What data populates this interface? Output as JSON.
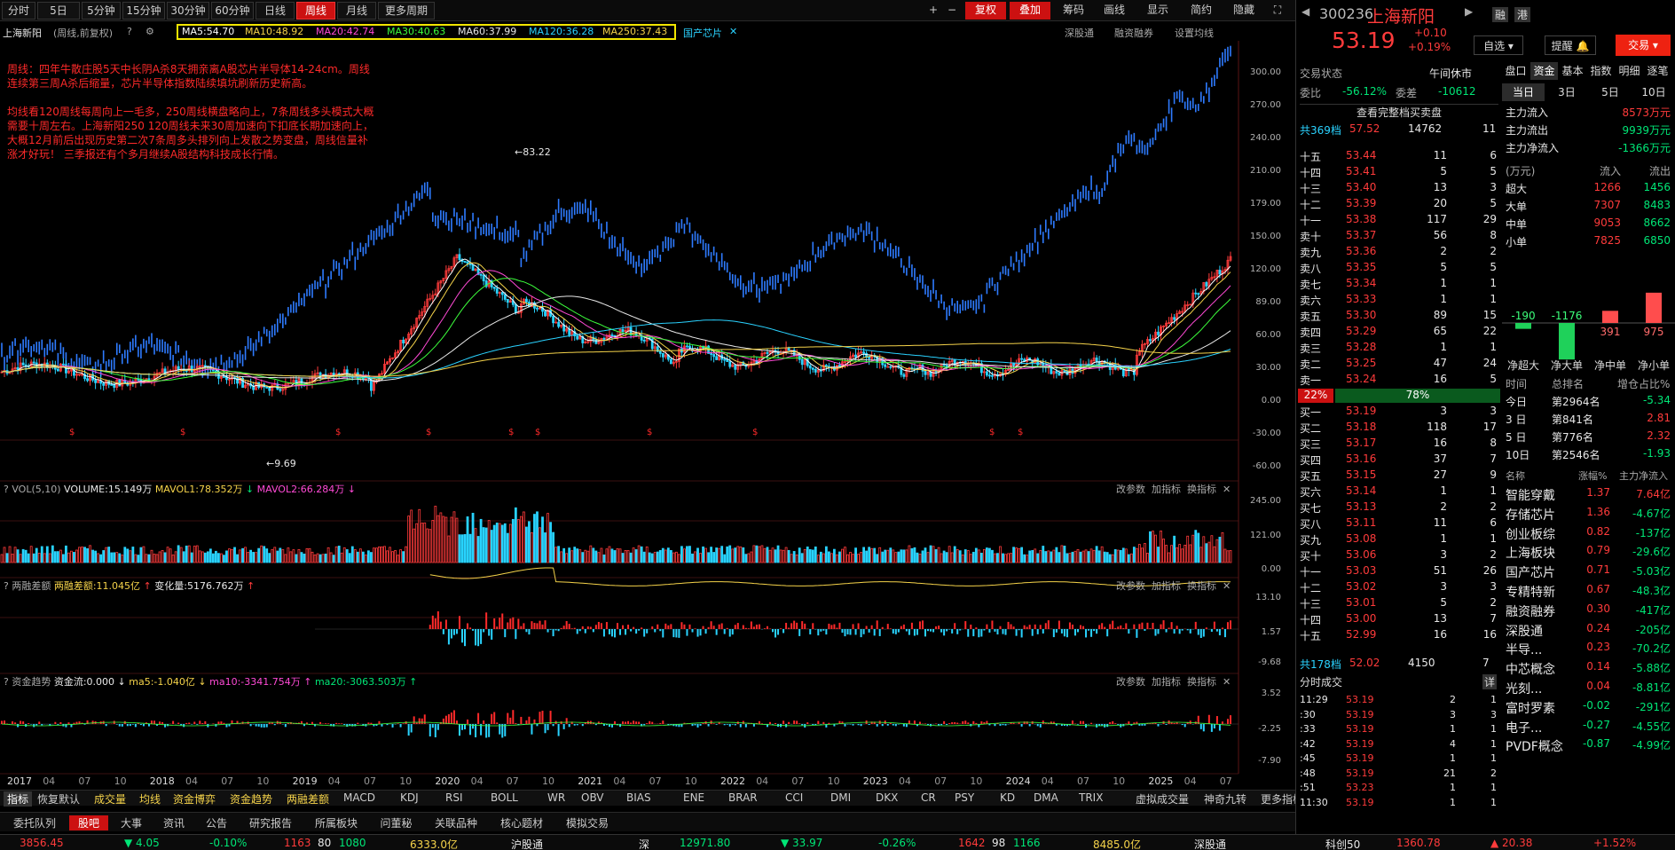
{
  "toolbar": {
    "items": [
      "分时",
      "5日",
      "5分钟",
      "15分钟",
      "30分钟",
      "60分钟",
      "日线",
      "周线",
      "月线",
      "更多周期"
    ],
    "right": [
      "复权",
      "叠加",
      "筹码",
      "画线",
      "显示",
      "简约",
      "隐藏"
    ]
  },
  "chart_header": {
    "name": "上海新阳",
    "period": "(周线,前复权)",
    "ma": [
      "MA5:54.70",
      "MA10:48.92",
      "MA20:42.74",
      "MA30:40.63",
      "MA60:37.99",
      "MA120:36.28",
      "MA250:37.43"
    ],
    "ma_colors": [
      "#ffffff",
      "#f5d34a",
      "#ff4ad6",
      "#3cff3c",
      "#e8e8e8",
      "#2ad2ff",
      "#f5d34a"
    ],
    "overlay": "国产芯片",
    "right_links": [
      "深股通",
      "融资融券",
      "设置均线"
    ]
  },
  "annotation": [
    "周线：四年牛散庄股5天中长阴A杀8天拥亲离A股芯片半导体14-24cm。周线",
    "连续第三周A杀后缩量，芯片半导体指数陆续填坑刷新历史新高。",
    "",
    "均线看120周线每周向上一毛多，250周线横盘略向上，7条周线多头模式大概",
    "需要十周左右。上海新阳250 120周线未来30周加速向下扣底长期加速向上，",
    "大概12月前后出现历史第二次7条周多头排列向上发散之势变盘，周线信量补",
    "涨才好玩！ 三季报还有个多月继续A股结构科技成长行情。"
  ],
  "main_y": [
    "300.00",
    "270.00",
    "240.00",
    "210.00",
    "179.00",
    "150.00",
    "120.00",
    "89.00",
    "60.00",
    "30.00",
    "0.00",
    "-30.00",
    "-60.00"
  ],
  "max_label": "83.22",
  "min_label": "9.69",
  "vol": {
    "title": "VOL(5,10)",
    "items": [
      "VOLUME:15.149万",
      "MAVOL1:78.352万",
      "MAVOL2:66.284万"
    ],
    "y": [
      "245.00",
      "121.00",
      "0.00"
    ],
    "btns": [
      "改参数",
      "加指标",
      "换指标"
    ]
  },
  "margin": {
    "title": "两融差额",
    "items": [
      "两融差额:11.045亿",
      "变化量:5176.762万"
    ],
    "y": [
      "13.10",
      "1.57",
      "-9.68"
    ]
  },
  "fund": {
    "title": "资金趋势",
    "items": [
      "资金流:0.000",
      "ma5:-1.040亿",
      "ma10:-3341.754万",
      "ma20:-3063.503万"
    ],
    "y": [
      "3.52",
      "-2.25",
      "-7.90"
    ]
  },
  "xaxis": [
    "2017",
    "04",
    "07",
    "10",
    "2018",
    "04",
    "07",
    "10",
    "2019",
    "04",
    "07",
    "10",
    "2020",
    "04",
    "07",
    "10",
    "2021",
    "04",
    "07",
    "10",
    "2022",
    "04",
    "07",
    "10",
    "2023",
    "04",
    "07",
    "10",
    "2024",
    "04",
    "07",
    "10",
    "2025",
    "04",
    "07"
  ],
  "indicators": [
    "指标",
    "恢复默认",
    "成交量",
    "均线",
    "资金博弈",
    "资金趋势",
    "两融差额",
    "MACD",
    "KDJ",
    "RSI",
    "BOLL",
    "WR",
    "OBV",
    "BIAS",
    "ENE",
    "BRAR",
    "CCI",
    "DMI",
    "DKX",
    "CR",
    "PSY",
    "KD",
    "DMA",
    "TRIX",
    "虚拟成交量",
    "神奇九转",
    "更多指标",
    "模板"
  ],
  "tabs": [
    "委托队列",
    "股吧",
    "大事",
    "资讯",
    "公告",
    "研究报告",
    "所属板块",
    "问董秘",
    "关联品种",
    "核心题材",
    "模拟交易"
  ],
  "status": {
    "idx1": "3856.45",
    "chg1": "4.05",
    "pct1": "-0.10%",
    "a1": "1163",
    "b1": "80",
    "c1": "1080",
    "amt1": "6333.0亿",
    "hgt": "沪股通",
    "sz": "深",
    "idx2": "12971.80",
    "chg2": "33.97",
    "pct2": "-0.26%",
    "a2": "1642",
    "b2": "98",
    "c2": "1166",
    "amt2": "8485.0亿",
    "sgt": "深股通",
    "kc": "科创50",
    "idx3": "1360.78",
    "chg3": "20.38",
    "pct3": "+1.52%"
  },
  "quote": {
    "code": "300236",
    "name": "上海新阳",
    "price": "53.19",
    "chg": "+0.10",
    "pct": "+0.19%",
    "btn_zx": "自选",
    "btn_tx": "提醒",
    "btn_jy": "交易",
    "tags": [
      "融",
      "港"
    ]
  },
  "rtabs": [
    "盘口",
    "资金",
    "基本",
    "指数",
    "明细",
    "逐笔"
  ],
  "state": {
    "label": "交易状态",
    "value": "午间休市",
    "wb_label": "委比",
    "wb": "-56.12%",
    "wc_label": "委差",
    "wc": "-10612",
    "full": "查看完整档买卖盘",
    "sum_label": "共369档",
    "sum_p": "57.52",
    "sum_v": "14762",
    "sum_n": "11"
  },
  "asks": [
    [
      "十五",
      "53.44",
      "11",
      "6"
    ],
    [
      "十四",
      "53.41",
      "5",
      "5"
    ],
    [
      "十三",
      "53.40",
      "13",
      "3"
    ],
    [
      "十二",
      "53.39",
      "20",
      "5"
    ],
    [
      "十一",
      "53.38",
      "117",
      "29"
    ],
    [
      "卖十",
      "53.37",
      "56",
      "8"
    ],
    [
      "卖九",
      "53.36",
      "2",
      "2"
    ],
    [
      "卖八",
      "53.35",
      "5",
      "5"
    ],
    [
      "卖七",
      "53.34",
      "1",
      "1"
    ],
    [
      "卖六",
      "53.33",
      "1",
      "1"
    ],
    [
      "卖五",
      "53.30",
      "89",
      "15"
    ],
    [
      "卖四",
      "53.29",
      "65",
      "22"
    ],
    [
      "卖三",
      "53.28",
      "1",
      "1"
    ],
    [
      "卖二",
      "53.25",
      "47",
      "24"
    ],
    [
      "卖一",
      "53.24",
      "16",
      "5"
    ]
  ],
  "ratio": [
    "22%",
    "78%"
  ],
  "bids": [
    [
      "买一",
      "53.19",
      "3",
      "3"
    ],
    [
      "买二",
      "53.18",
      "118",
      "17"
    ],
    [
      "买三",
      "53.17",
      "16",
      "8"
    ],
    [
      "买四",
      "53.16",
      "37",
      "7"
    ],
    [
      "买五",
      "53.15",
      "27",
      "9"
    ],
    [
      "买六",
      "53.14",
      "1",
      "1"
    ],
    [
      "买七",
      "53.13",
      "2",
      "2"
    ],
    [
      "买八",
      "53.11",
      "11",
      "6"
    ],
    [
      "买九",
      "53.08",
      "1",
      "1"
    ],
    [
      "买十",
      "53.06",
      "3",
      "2"
    ],
    [
      "十一",
      "53.03",
      "51",
      "26"
    ],
    [
      "十二",
      "53.02",
      "3",
      "3"
    ],
    [
      "十三",
      "53.01",
      "5",
      "2"
    ],
    [
      "十四",
      "53.00",
      "13",
      "7"
    ],
    [
      "十五",
      "52.99",
      "16",
      "16"
    ]
  ],
  "bid_sum": {
    "label": "共178档",
    "p": "52.02",
    "v": "4150",
    "n": "7"
  },
  "ticks_title": "分时成交",
  "ticks_btn": "详",
  "ticks": [
    [
      "11:29",
      "53.19",
      "2",
      "1"
    ],
    [
      ":30",
      "53.19",
      "3",
      "3"
    ],
    [
      ":33",
      "53.19",
      "1",
      "1"
    ],
    [
      ":42",
      "53.19",
      "4",
      "1"
    ],
    [
      ":45",
      "53.19",
      "1",
      "1"
    ],
    [
      ":48",
      "53.19",
      "21",
      "2"
    ],
    [
      ":51",
      "53.23",
      "1",
      "1"
    ],
    [
      "11:30",
      "53.19",
      "1",
      "1"
    ]
  ],
  "fund_tabs": [
    "当日",
    "3日",
    "5日",
    "10日"
  ],
  "flow": [
    [
      "主力流入",
      "8573万元"
    ],
    [
      "主力流出",
      "9939万元"
    ],
    [
      "主力净流入",
      "-1366万元"
    ]
  ],
  "flow_tbl_hdr": [
    "(万元)",
    "流入",
    "流出"
  ],
  "flow_tbl": [
    [
      "超大",
      "1266",
      "1456"
    ],
    [
      "大单",
      "7307",
      "8483"
    ],
    [
      "中单",
      "9053",
      "8662"
    ],
    [
      "小单",
      "7825",
      "6850"
    ]
  ],
  "net_bars": [
    {
      "label": "净超大",
      "value": -190
    },
    {
      "label": "净大单",
      "value": -1176
    },
    {
      "label": "净中单",
      "value": 391
    },
    {
      "label": "净小单",
      "value": 975
    }
  ],
  "rank_hdr": [
    "时间",
    "总排名",
    "增仓占比%"
  ],
  "ranks": [
    [
      "今日",
      "第2964名",
      "-5.34"
    ],
    [
      "3 日",
      "第841名",
      "2.81"
    ],
    [
      "5 日",
      "第776名",
      "2.32"
    ],
    [
      "10日",
      "第2546名",
      "-1.93"
    ]
  ],
  "sect_hdr": [
    "名称",
    "涨幅%",
    "主力净流入"
  ],
  "sectors": [
    [
      "智能穿戴",
      "1.37",
      "7.64亿"
    ],
    [
      "存储芯片",
      "1.36",
      "-4.67亿"
    ],
    [
      "创业板综",
      "0.82",
      "-137亿"
    ],
    [
      "上海板块",
      "0.79",
      "-29.6亿"
    ],
    [
      "国产芯片",
      "0.71",
      "-5.03亿"
    ],
    [
      "专精特新",
      "0.67",
      "-48.3亿"
    ],
    [
      "融资融券",
      "0.30",
      "-417亿"
    ],
    [
      "深股通",
      "0.24",
      "-205亿"
    ],
    [
      "半导...",
      "0.23",
      "-70.2亿"
    ],
    [
      "中芯概念",
      "0.14",
      "-5.88亿"
    ],
    [
      "光刻...",
      "0.04",
      "-8.81亿"
    ],
    [
      "富时罗素",
      "-0.02",
      "-291亿"
    ],
    [
      "电子...",
      "-0.27",
      "-4.55亿"
    ],
    [
      "PVDF概念",
      "-0.87",
      "-4.99亿"
    ]
  ]
}
